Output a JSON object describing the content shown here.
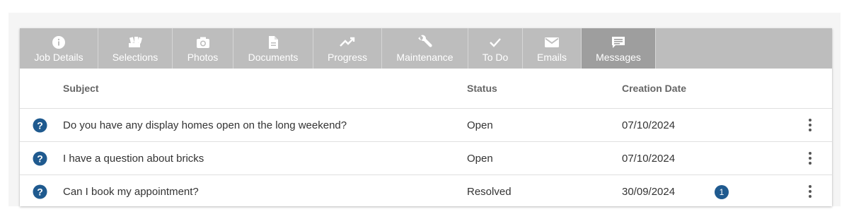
{
  "tabs": [
    {
      "label": "Job Details",
      "icon": "info-icon"
    },
    {
      "label": "Selections",
      "icon": "selections-icon"
    },
    {
      "label": "Photos",
      "icon": "camera-icon"
    },
    {
      "label": "Documents",
      "icon": "document-icon"
    },
    {
      "label": "Progress",
      "icon": "trending-up-icon"
    },
    {
      "label": "Maintenance",
      "icon": "wrench-icon"
    },
    {
      "label": "To Do",
      "icon": "check-icon"
    },
    {
      "label": "Emails",
      "icon": "mail-icon"
    },
    {
      "label": "Messages",
      "icon": "message-icon",
      "active": true
    }
  ],
  "table": {
    "headers": {
      "subject": "Subject",
      "status": "Status",
      "creation_date": "Creation Date"
    },
    "rows": [
      {
        "subject": "Do you have any display homes open on the long weekend?",
        "status": "Open",
        "creation_date": "07/10/2024",
        "badge": ""
      },
      {
        "subject": "I have a question about bricks",
        "status": "Open",
        "creation_date": "07/10/2024",
        "badge": ""
      },
      {
        "subject": "Can I book my appointment?",
        "status": "Resolved",
        "creation_date": "30/09/2024",
        "badge": "1"
      }
    ]
  },
  "colors": {
    "tab_bar": "#bdbdbd",
    "tab_active": "#9e9e9e",
    "accent": "#1f5a8f"
  }
}
